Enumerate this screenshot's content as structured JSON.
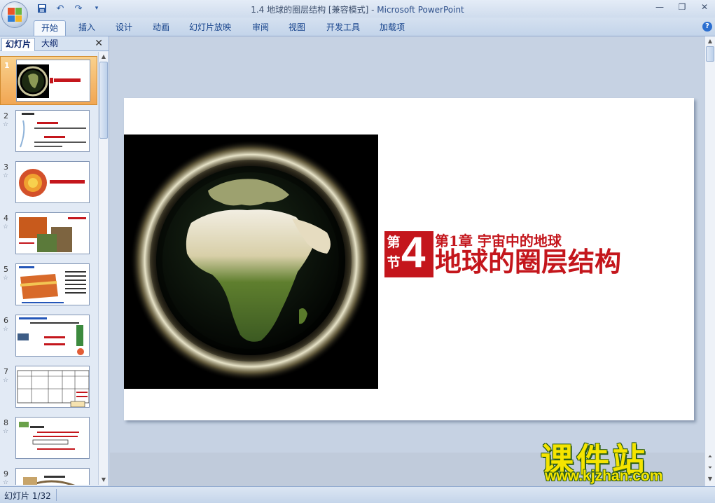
{
  "window": {
    "title_doc": "1.4 地球的圈层结构 [兼容模式]",
    "title_sep": " - ",
    "title_app": "Microsoft PowerPoint"
  },
  "qat": {
    "icons": [
      "save-icon",
      "undo-icon",
      "redo-icon",
      "customize-qat-icon"
    ]
  },
  "ribbon": {
    "tabs": [
      "开始",
      "插入",
      "设计",
      "动画",
      "幻灯片放映",
      "审阅",
      "视图",
      "开发工具",
      "加载项"
    ],
    "active_tab": "开始"
  },
  "panel": {
    "tabs": [
      "幻灯片",
      "大纲"
    ],
    "active_tab": "幻灯片",
    "slides": [
      {
        "num": "1",
        "selected": true
      },
      {
        "num": "2",
        "selected": false
      },
      {
        "num": "3",
        "selected": false
      },
      {
        "num": "4",
        "selected": false
      },
      {
        "num": "5",
        "selected": false
      },
      {
        "num": "6",
        "selected": false
      },
      {
        "num": "7",
        "selected": false
      },
      {
        "num": "8",
        "selected": false
      },
      {
        "num": "9",
        "selected": false
      }
    ]
  },
  "slide": {
    "section_char": "第节",
    "section_num": "4",
    "chapter": "第1章 宇宙中的地球",
    "title": "地球的圈层结构"
  },
  "watermark": {
    "cn": "课件站",
    "url": "www.kjzhan.com"
  },
  "status": {
    "slide_counter": "幻灯片 1/32"
  },
  "colors": {
    "accent_red": "#c4161c",
    "selection": "#f1a653",
    "watermark_yellow": "#f5e400"
  }
}
